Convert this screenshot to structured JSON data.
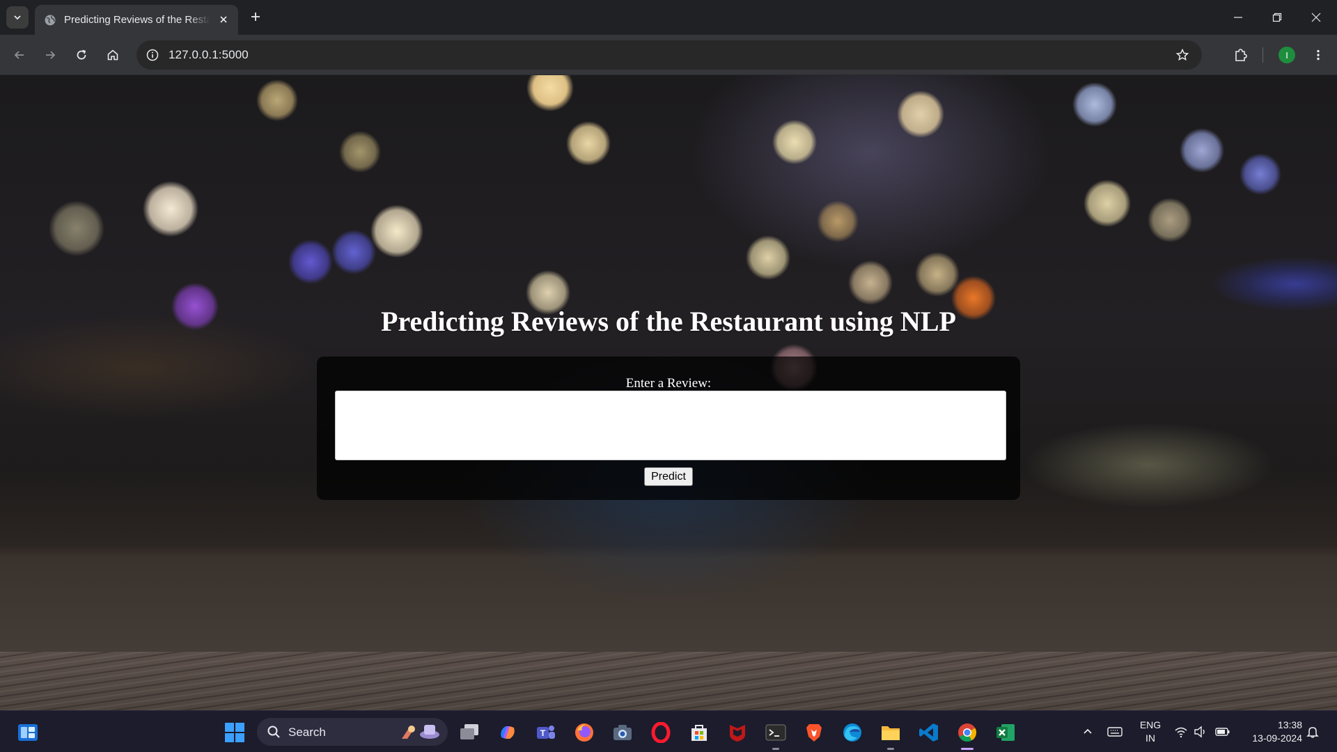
{
  "browser": {
    "tab_title": "Predicting Reviews of the Restaurant using NLP",
    "url": "127.0.0.1:5000",
    "profile_initial": "I"
  },
  "page": {
    "heading": "Predicting Reviews of the Restaurant using NLP",
    "review_label": "Enter a Review:",
    "review_value": "",
    "predict_button": "Predict"
  },
  "taskbar": {
    "search_label": "Search",
    "language_line1": "ENG",
    "language_line2": "IN",
    "time": "13:38",
    "date": "13-09-2024",
    "pinned_apps": [
      "widgets-icon",
      "start-icon",
      "task-view-icon",
      "copilot-icon",
      "teams-icon",
      "firefox-icon",
      "camera-icon",
      "opera-icon",
      "microsoft-store-icon",
      "mcafee-icon",
      "terminal-icon",
      "brave-icon",
      "edge-icon",
      "file-explorer-icon",
      "vscode-icon",
      "chrome-icon",
      "excel-icon"
    ]
  },
  "colors": {
    "chrome_dark": "#202124",
    "toolbar": "#35363a",
    "taskbar": "#1c1c2c",
    "card_overlay": "rgba(0,0,0,0.72)",
    "profile_green": "#1e8e3e"
  }
}
